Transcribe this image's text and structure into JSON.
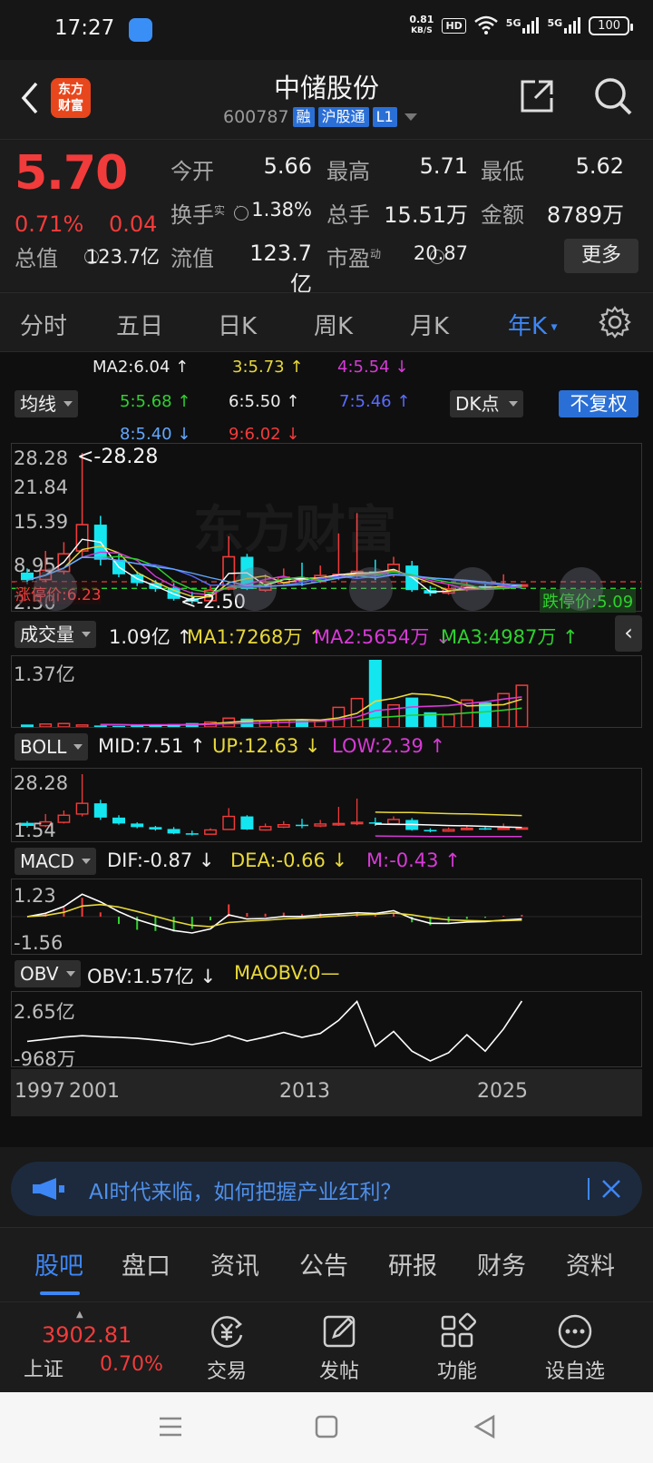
{
  "status_bar": {
    "time": "17:27",
    "net_speed_value": "0.81",
    "net_speed_unit": "KB/S",
    "hd_badge": "HD",
    "signal_1": "5G",
    "signal_2": "5G",
    "battery": "100"
  },
  "header": {
    "name": "中储股份",
    "code": "600787",
    "tag_rong": "融",
    "tag_hgt": "沪股通",
    "tag_level": "L1",
    "logo_line1": "东方",
    "logo_line2": "财富"
  },
  "quote": {
    "price": "5.70",
    "change_pct": "0.71%",
    "change_amt": "0.04",
    "open_label": "今开",
    "open": "5.66",
    "high_label": "最高",
    "high": "5.71",
    "low_label": "最低",
    "low": "5.62",
    "turnover_label": "换手",
    "turnover_sup": "实",
    "turnover": "1.38%",
    "volume_label": "总手",
    "volume": "15.51万",
    "amount_label": "金额",
    "amount": "8789万",
    "mktcap_label": "总值",
    "mktcap": "123.7亿",
    "float_label": "流值",
    "float": "123.7亿",
    "pe_label": "市盈",
    "pe_sup": "动",
    "pe": "20.87",
    "more": "更多"
  },
  "period_tabs": [
    "分时",
    "五日",
    "日K",
    "周K",
    "月K",
    "年K"
  ],
  "ma_legend": {
    "selector": "均线",
    "ma2": "MA2:6.04",
    "ma3": "3:5.73",
    "ma4": "4:5.54",
    "ma5": "5:5.68",
    "ma6": "6:5.50",
    "ma7": "7:5.46",
    "ma8": "8:5.40",
    "ma9": "9:6.02",
    "dk": "DK点",
    "unadjusted": "不复权"
  },
  "price_chart": {
    "y_labels": [
      "28.28",
      "21.84",
      "15.39",
      "8.95",
      "2.50"
    ],
    "max_note": "<-28.28",
    "min_note": "<-2.50",
    "limit_up": "涨停价:6.23",
    "limit_down": "跌停价:5.09",
    "watermark": "东方财富"
  },
  "volume_panel": {
    "selector": "成交量",
    "value": "1.09亿",
    "ma1": "MA1:7268万",
    "ma2": "MA2:5654万",
    "ma3": "MA3:4987万",
    "y_max": "1.37亿"
  },
  "boll_panel": {
    "selector": "BOLL",
    "mid": "MID:7.51",
    "up": "UP:12.63",
    "low": "LOW:2.39",
    "y_max": "28.28",
    "y_min": "1.54"
  },
  "macd_panel": {
    "selector": "MACD",
    "dif": "DIF:-0.87",
    "dea": "DEA:-0.66",
    "m": "M:-0.43",
    "y_max": "1.23",
    "y_min": "-1.56"
  },
  "obv_panel": {
    "selector": "OBV",
    "obv": "OBV:1.57亿",
    "maobv": "MAOBV:0",
    "y_max": "2.65亿",
    "y_min": "-968万"
  },
  "x_axis": [
    "1997",
    "2001",
    "2013",
    "2025"
  ],
  "ai_banner": {
    "text": "AI时代来临，如何把握产业红利？"
  },
  "bottom_tabs": [
    "股吧",
    "盘口",
    "资讯",
    "公告",
    "研报",
    "财务",
    "资料"
  ],
  "toolbar": {
    "index_value": "3902.81",
    "index_name": "上证",
    "index_pct": "0.70%",
    "trade": "交易",
    "post": "发帖",
    "functions": "功能",
    "watchlist": "设自选"
  },
  "candles": [
    {
      "o": 7.8,
      "c": 6.5,
      "h": 8.5,
      "l": 5.8
    },
    {
      "o": 6.6,
      "c": 8.2,
      "h": 11.5,
      "l": 6.0
    },
    {
      "o": 8.0,
      "c": 11.0,
      "h": 13.0,
      "l": 7.5
    },
    {
      "o": 11.5,
      "c": 16.0,
      "h": 28.28,
      "l": 10.5
    },
    {
      "o": 16.0,
      "c": 10.0,
      "h": 17.5,
      "l": 9.0
    },
    {
      "o": 10.0,
      "c": 7.5,
      "h": 11.0,
      "l": 7.0
    },
    {
      "o": 7.5,
      "c": 6.0,
      "h": 8.0,
      "l": 5.5
    },
    {
      "o": 6.0,
      "c": 5.0,
      "h": 6.5,
      "l": 4.5
    },
    {
      "o": 5.2,
      "c": 3.3,
      "h": 6.0,
      "l": 3.0
    },
    {
      "o": 3.4,
      "c": 2.8,
      "h": 4.5,
      "l": 2.5
    },
    {
      "o": 3.0,
      "c": 4.8,
      "h": 5.5,
      "l": 2.9
    },
    {
      "o": 5.0,
      "c": 10.5,
      "h": 14.0,
      "l": 4.8
    },
    {
      "o": 10.5,
      "c": 5.0,
      "h": 11.0,
      "l": 4.8
    },
    {
      "o": 4.8,
      "c": 6.2,
      "h": 7.5,
      "l": 4.5
    },
    {
      "o": 6.0,
      "c": 7.0,
      "h": 8.5,
      "l": 5.6
    },
    {
      "o": 7.0,
      "c": 6.5,
      "h": 9.5,
      "l": 5.5
    },
    {
      "o": 6.5,
      "c": 7.3,
      "h": 9.0,
      "l": 6.0
    },
    {
      "o": 7.0,
      "c": 7.5,
      "h": 14.5,
      "l": 6.5
    },
    {
      "o": 7.5,
      "c": 8.0,
      "h": 18.0,
      "l": 6.8
    },
    {
      "o": 8.0,
      "c": 7.5,
      "h": 10.0,
      "l": 6.5
    },
    {
      "o": 7.4,
      "c": 9.2,
      "h": 10.5,
      "l": 7.0
    },
    {
      "o": 9.0,
      "c": 4.8,
      "h": 9.8,
      "l": 4.5
    },
    {
      "o": 4.8,
      "c": 4.2,
      "h": 5.5,
      "l": 3.8
    },
    {
      "o": 4.3,
      "c": 5.0,
      "h": 5.8,
      "l": 4.0
    },
    {
      "o": 5.0,
      "c": 5.5,
      "h": 6.3,
      "l": 4.6
    },
    {
      "o": 5.5,
      "c": 5.1,
      "h": 6.0,
      "l": 4.8
    },
    {
      "o": 5.1,
      "c": 5.6,
      "h": 7.5,
      "l": 4.8
    },
    {
      "o": 5.66,
      "c": 5.7,
      "h": 5.71,
      "l": 5.62
    }
  ],
  "volumes": [
    0.05,
    0.06,
    0.07,
    0.04,
    0.03,
    0.02,
    0.03,
    0.05,
    0.06,
    0.08,
    0.1,
    0.18,
    0.17,
    0.12,
    0.14,
    0.15,
    0.12,
    0.4,
    0.58,
    1.37,
    0.45,
    0.6,
    0.3,
    0.25,
    0.55,
    0.5,
    0.68,
    0.85
  ]
}
